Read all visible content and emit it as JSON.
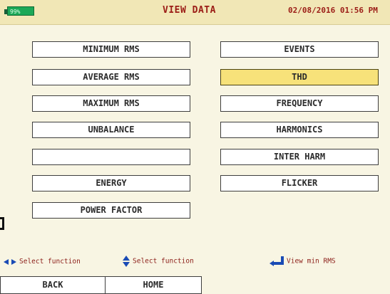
{
  "header": {
    "battery": "99%",
    "title": "VIEW DATA",
    "datetime": "02/08/2016 01:56 PM"
  },
  "left_menu": [
    {
      "label": "MINIMUM RMS",
      "selected": false
    },
    {
      "label": "AVERAGE RMS",
      "selected": false
    },
    {
      "label": "MAXIMUM RMS",
      "selected": false
    },
    {
      "label": "UNBALANCE",
      "selected": false
    },
    {
      "label": "",
      "selected": false
    },
    {
      "label": "ENERGY",
      "selected": false
    },
    {
      "label": "POWER FACTOR",
      "selected": false
    }
  ],
  "right_menu": [
    {
      "label": "EVENTS",
      "selected": false
    },
    {
      "label": "THD",
      "selected": true
    },
    {
      "label": "FREQUENCY",
      "selected": false
    },
    {
      "label": "HARMONICS",
      "selected": false
    },
    {
      "label": "INTER HARM",
      "selected": false
    },
    {
      "label": "FLICKER",
      "selected": false
    }
  ],
  "hints": [
    {
      "icon": "left-right-arrows-icon",
      "text": "Select function"
    },
    {
      "icon": "up-down-arrows-icon",
      "text": "Select function"
    },
    {
      "icon": "enter-arrow-icon",
      "text": "View min RMS"
    }
  ],
  "softkeys": [
    {
      "label": "BACK"
    },
    {
      "label": "HOME"
    }
  ],
  "colors": {
    "header_bg": "#f1e7b6",
    "title_text": "#9b1c16",
    "selected_bg": "#f7e27a",
    "icon_blue": "#1a4bb5",
    "battery_green": "#1ca857"
  }
}
